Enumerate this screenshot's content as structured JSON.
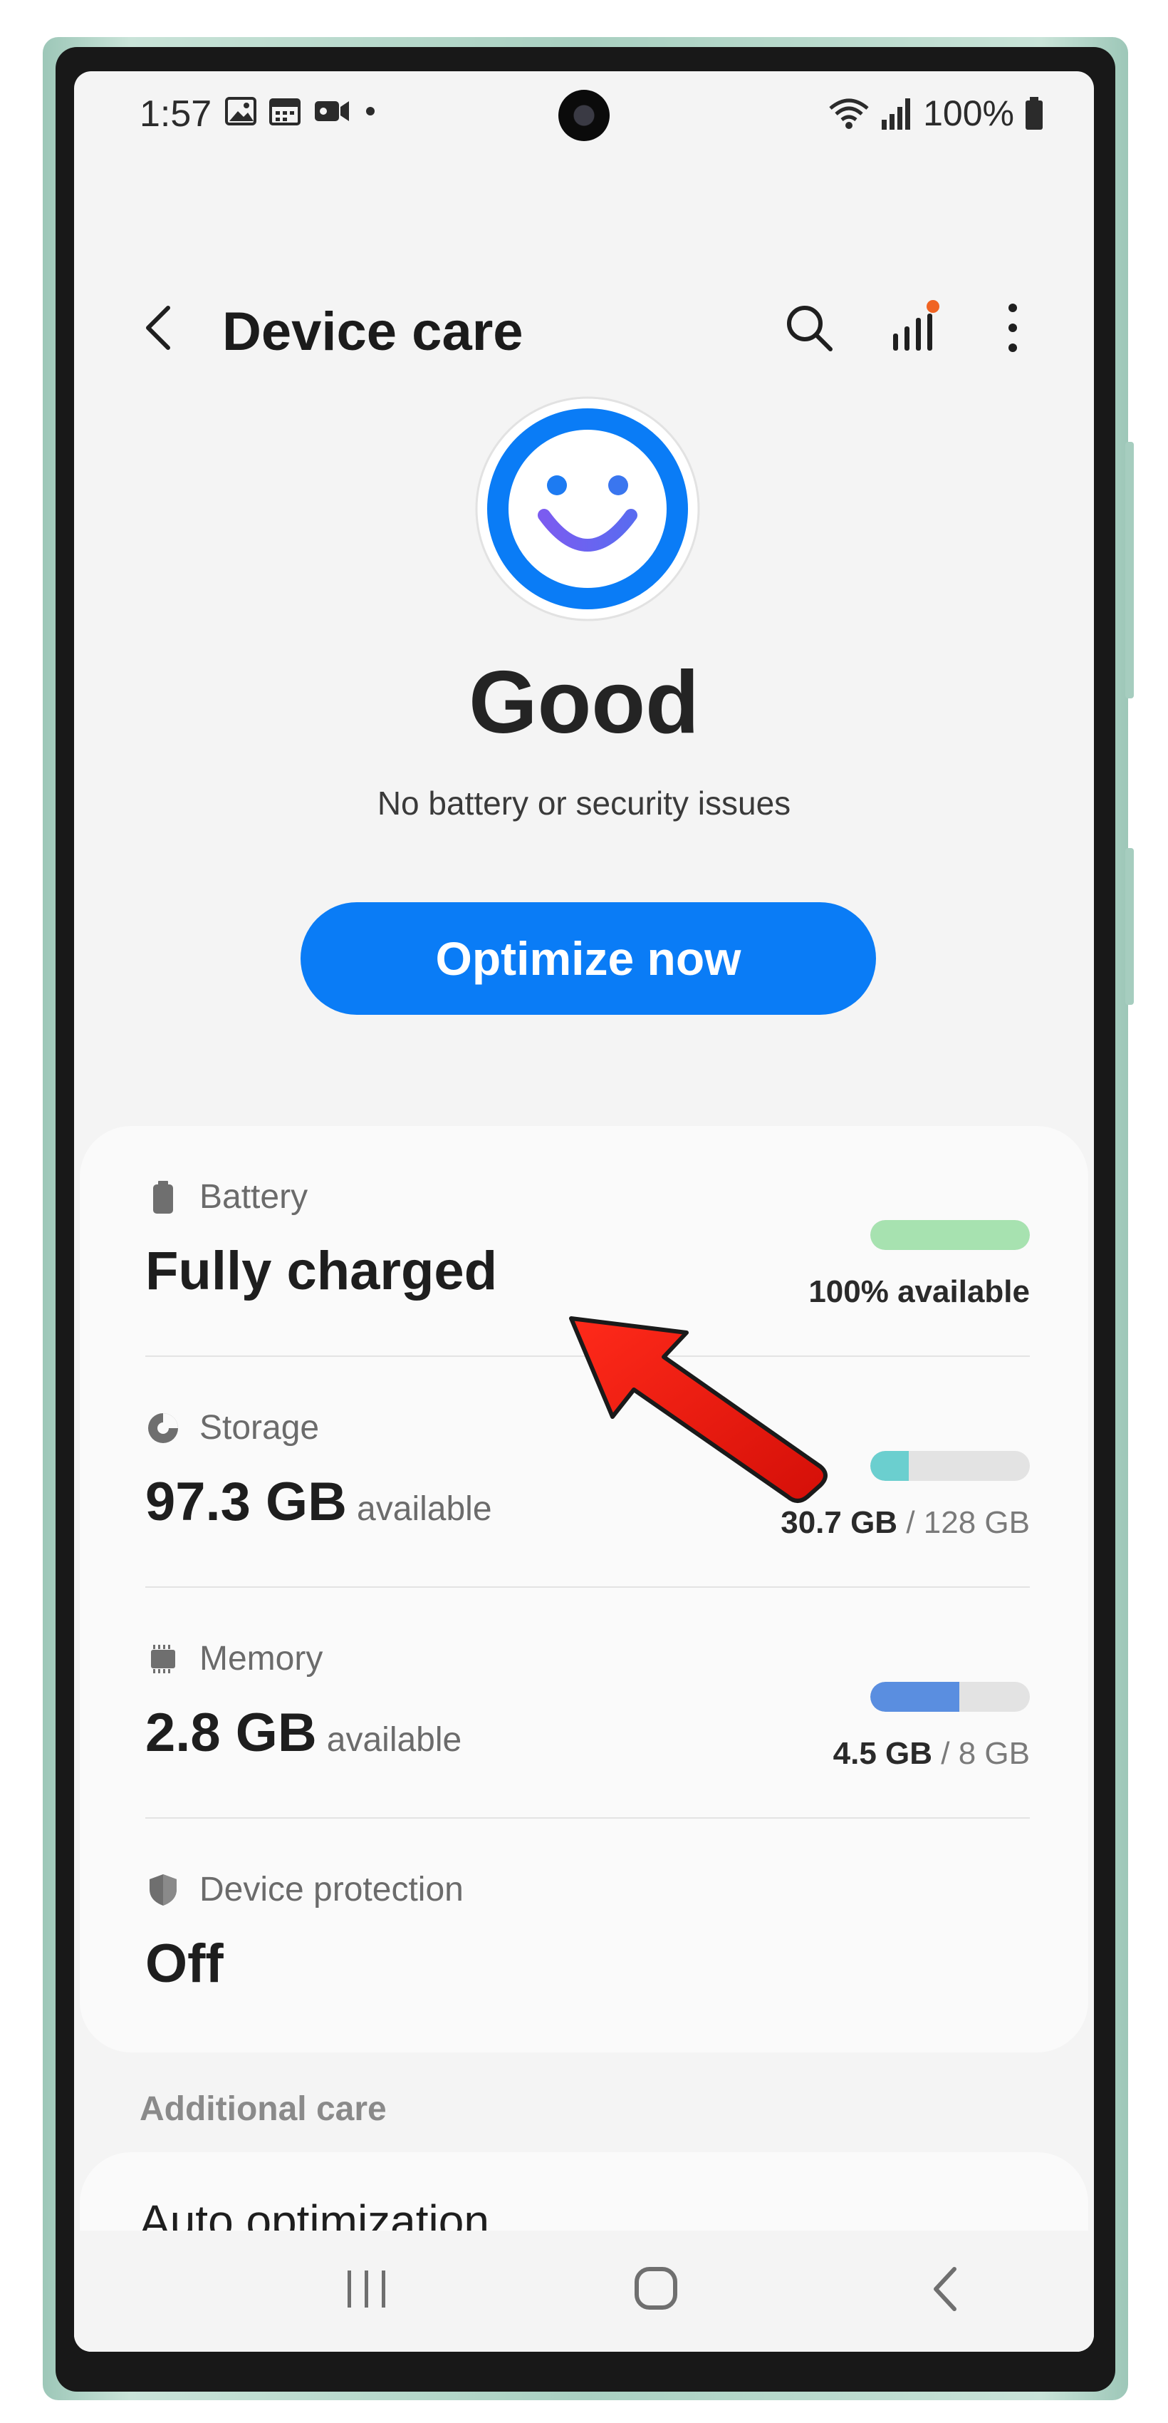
{
  "status_bar": {
    "time": "1:57",
    "battery": "100%"
  },
  "header": {
    "title": "Device care"
  },
  "summary": {
    "status": "Good",
    "subtitle": "No battery or security issues",
    "button_label": "Optimize now"
  },
  "colors": {
    "accent": "#0a7cf6",
    "battery_bar": "#a7e2b0",
    "storage_bar": "#6bcfcf",
    "memory_bar": "#5a8ee0",
    "alert_dot": "#f06423"
  },
  "care_items": {
    "battery": {
      "label": "Battery",
      "value": "Fully charged",
      "detail": "100% available",
      "level": 1.0
    },
    "storage": {
      "label": "Storage",
      "value": "97.3 GB",
      "unit": "available",
      "used": "30.7 GB",
      "total": "/ 128 GB",
      "level": 0.24
    },
    "memory": {
      "label": "Memory",
      "value": "2.8 GB",
      "unit": "available",
      "used": "4.5 GB",
      "total": "/ 8 GB",
      "level": 0.56
    },
    "protection": {
      "label": "Device protection",
      "value": "Off"
    }
  },
  "additional_care": {
    "header": "Additional care",
    "first_item": "Auto optimization"
  },
  "icons": {
    "back": "chevron-left-icon",
    "search": "search-icon",
    "stats": "signal-bars-icon",
    "more": "more-vertical-icon",
    "battery": "battery-icon",
    "storage": "pie-chart-icon",
    "memory": "chip-icon",
    "protection": "shield-icon"
  }
}
